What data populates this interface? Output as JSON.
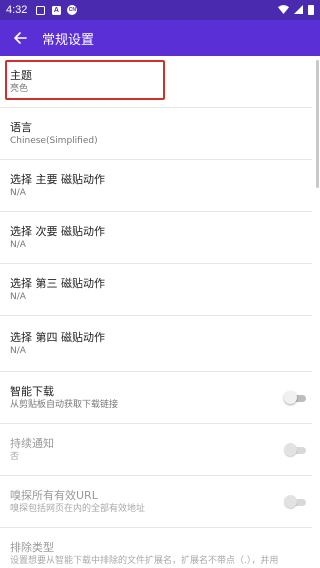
{
  "status_bar": {
    "time": "4:32",
    "icons": [
      "gallery-icon",
      "a-icon",
      "cn-icon"
    ],
    "cn_text": "CN",
    "a_text": "A"
  },
  "app_bar": {
    "title": "常规设置"
  },
  "settings": [
    {
      "title": "主题",
      "subtitle": "亮色"
    },
    {
      "title": "语言",
      "subtitle": "Chinese(Simplified)"
    },
    {
      "title": "选择 主要 磁贴动作",
      "subtitle": "N/A"
    },
    {
      "title": "选择 次要 磁贴动作",
      "subtitle": "N/A"
    },
    {
      "title": "选择 第三 磁贴动作",
      "subtitle": "N/A"
    },
    {
      "title": "选择 第四 磁贴动作",
      "subtitle": "N/A"
    },
    {
      "title": "智能下载",
      "subtitle": "从剪贴板自动获取下载链接",
      "toggle": false,
      "enabled": true
    },
    {
      "title": "持续通知",
      "subtitle": "否",
      "toggle": false,
      "enabled": false
    },
    {
      "title": "嗅探所有有效URL",
      "subtitle": "嗅探包括网页在内的全部有效地址",
      "toggle": false,
      "enabled": false
    },
    {
      "title": "排除类型",
      "subtitle": "设置想要从智能下载中排除的文件扩展名，扩展名不带点（.），并用"
    }
  ],
  "colors": {
    "status_bar": "#4a2bb0",
    "app_bar": "#5b2fd6",
    "highlight": "#d0312d"
  }
}
